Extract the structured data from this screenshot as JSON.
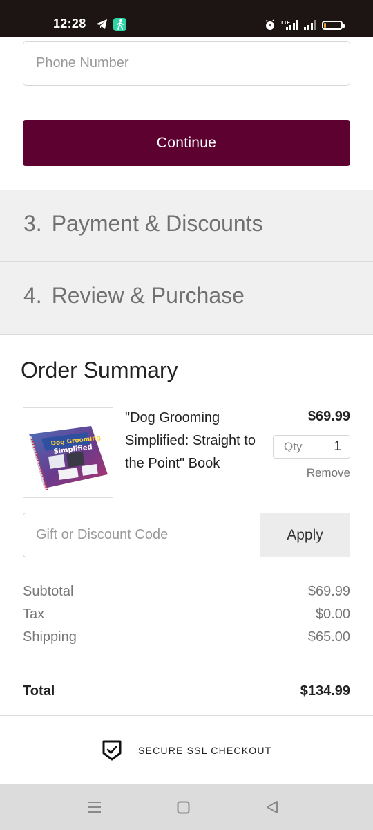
{
  "status_bar": {
    "time": "12:28",
    "network": "LTE",
    "icons": [
      "telegram-icon",
      "fitness-app-icon",
      "alarm-icon",
      "signal-icon",
      "signal-icon",
      "battery-icon"
    ]
  },
  "contact": {
    "phone_placeholder": "Phone Number",
    "phone_value": "",
    "continue_label": "Continue"
  },
  "steps": [
    {
      "number": "3.",
      "label": "Payment & Discounts"
    },
    {
      "number": "4.",
      "label": "Review & Purchase"
    }
  ],
  "order_summary": {
    "title": "Order Summary",
    "item": {
      "name": "\"Dog Grooming Simplified: Straight to the Point\" Book",
      "price": "$69.99",
      "qty_label": "Qty",
      "qty_value": "1",
      "remove_label": "Remove",
      "image_icon": "book-cover-image"
    },
    "discount": {
      "placeholder": "Gift or Discount Code",
      "apply_label": "Apply"
    },
    "lines": {
      "subtotal_label": "Subtotal",
      "subtotal_value": "$69.99",
      "tax_label": "Tax",
      "tax_value": "$0.00",
      "shipping_label": "Shipping",
      "shipping_value": "$65.00"
    },
    "total_label": "Total",
    "total_value": "$134.99",
    "ssl_text": "SECURE SSL CHECKOUT"
  },
  "colors": {
    "primary_button": "#5d0230",
    "step_background": "#f0f0f0",
    "status_bar": "#1d1414"
  }
}
